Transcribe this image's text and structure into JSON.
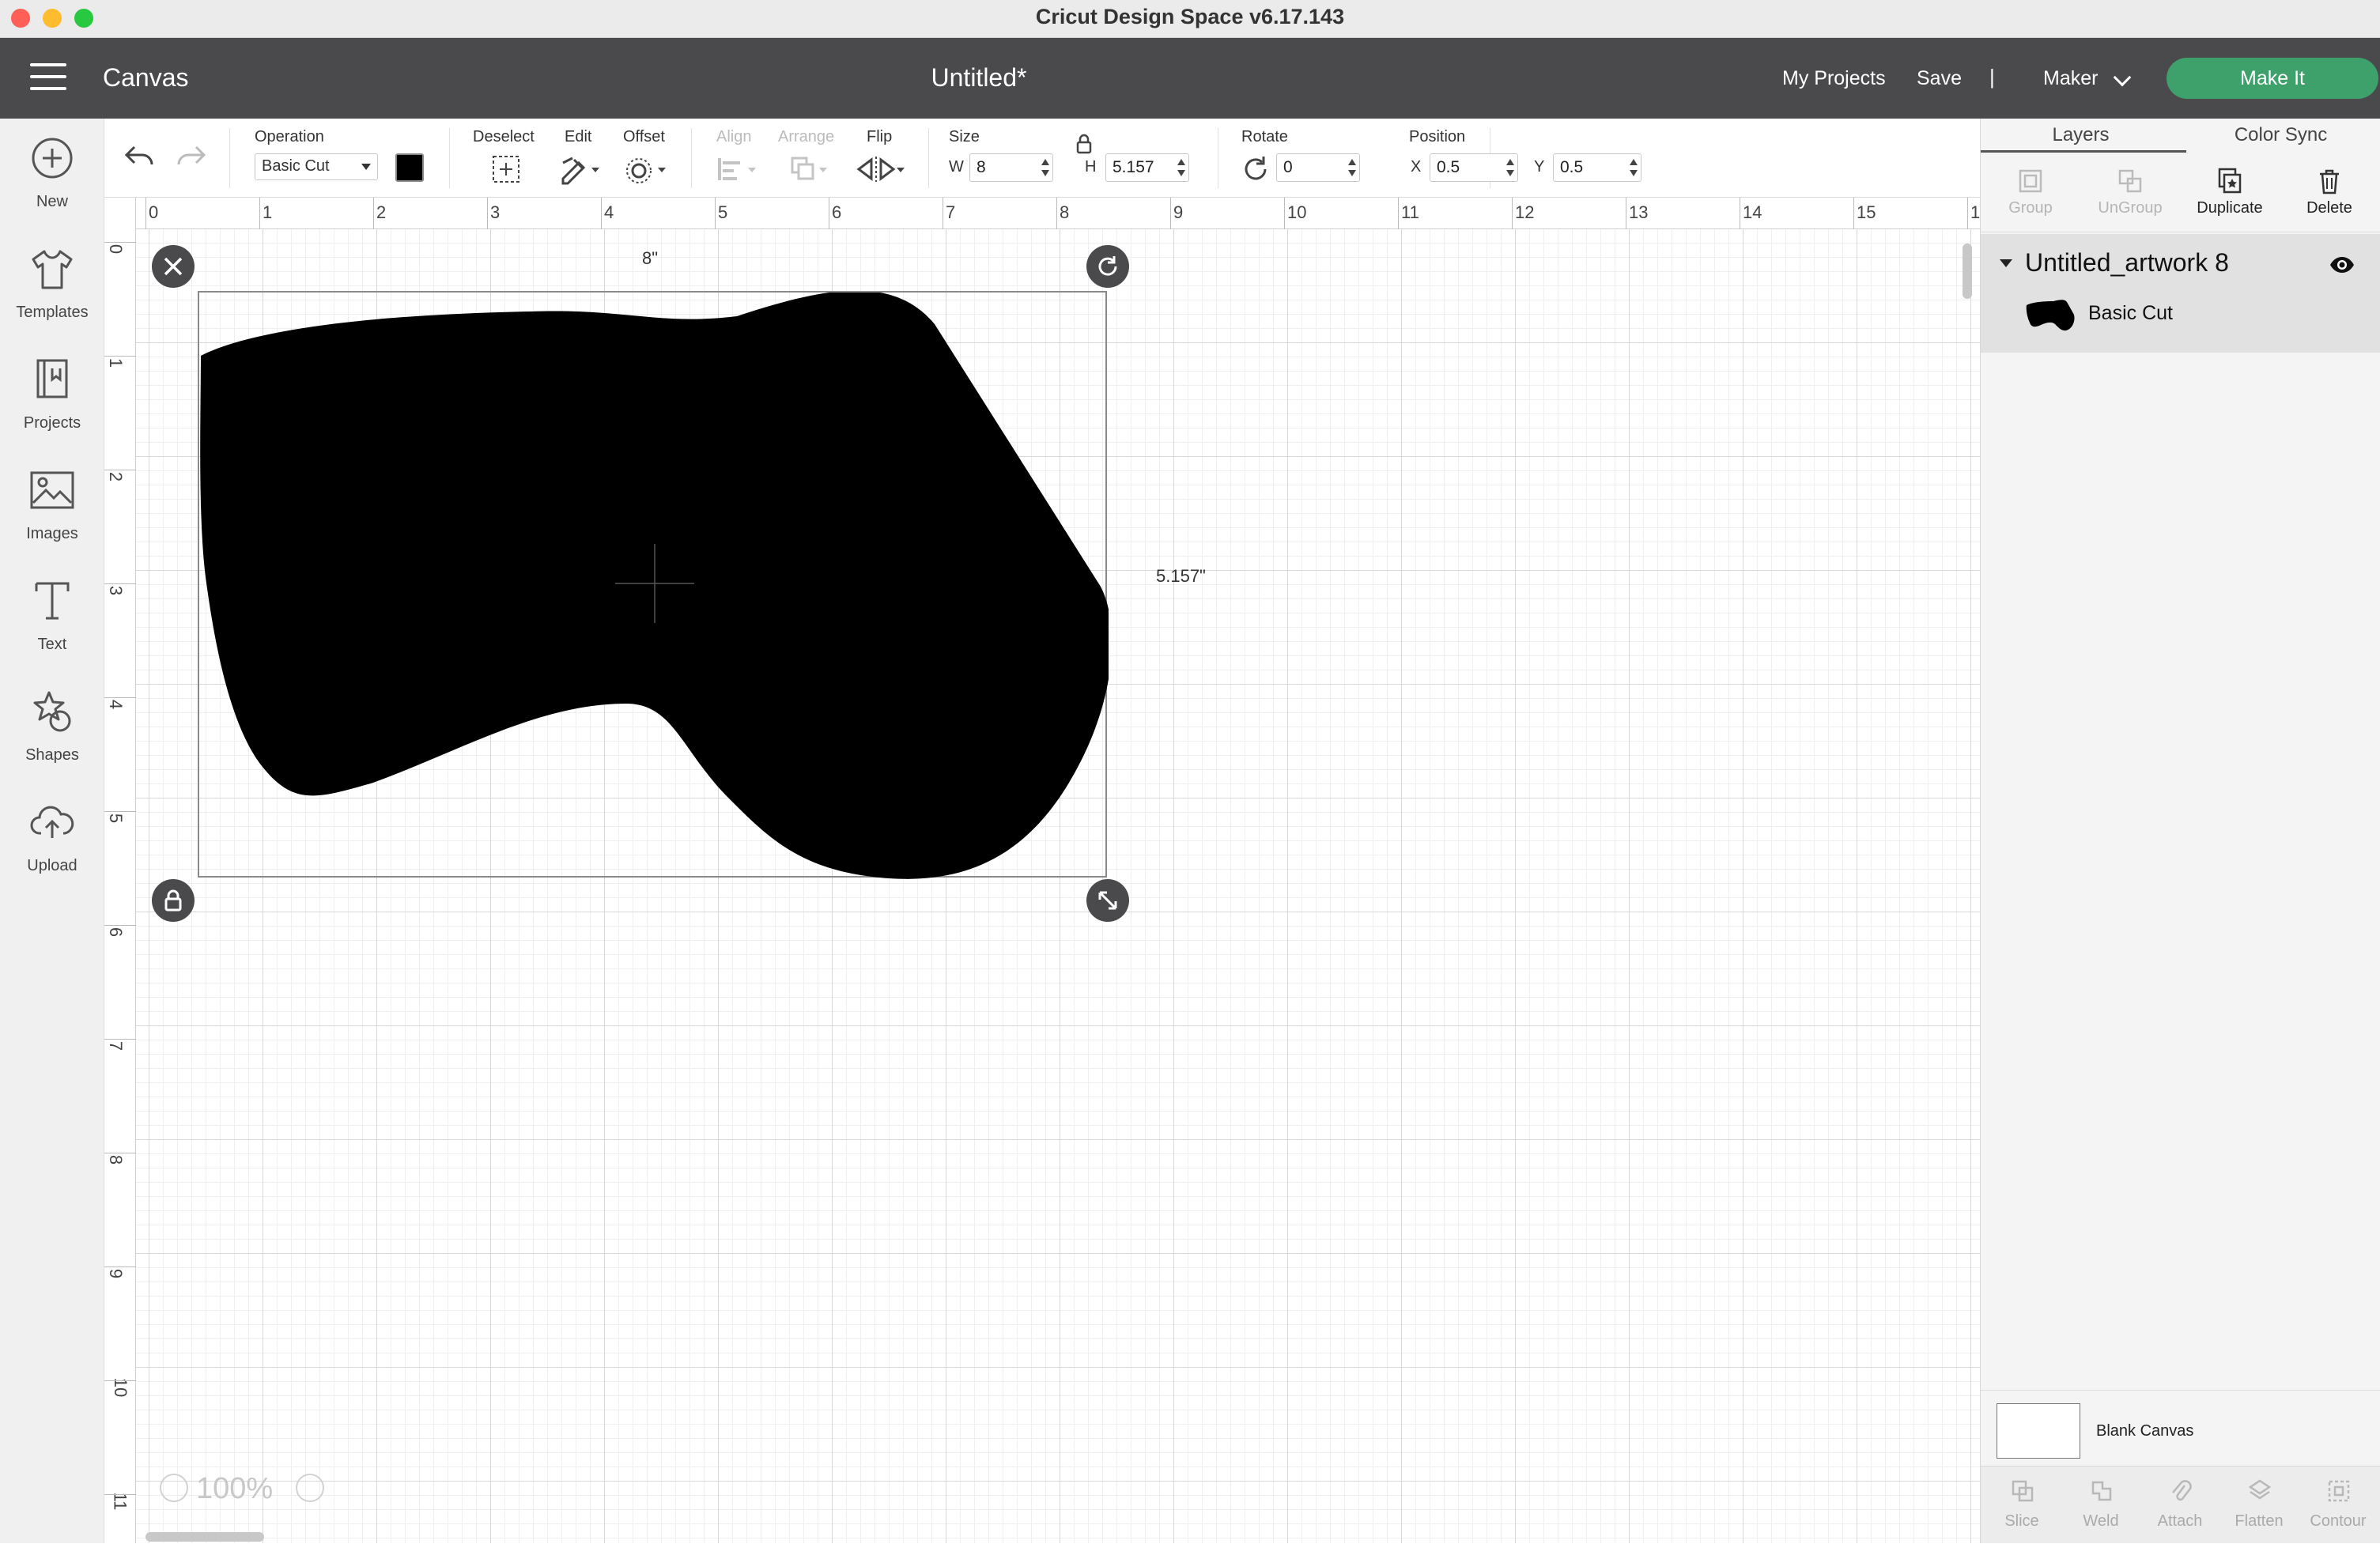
{
  "window": {
    "title": "Cricut Design Space  v6.17.143"
  },
  "header": {
    "section": "Canvas",
    "doc_title": "Untitled*",
    "my_projects": "My Projects",
    "save": "Save",
    "separator": "|",
    "machine": "Maker",
    "make_it": "Make It"
  },
  "sidebar": {
    "items": [
      {
        "label": "New",
        "icon": "plus-circle-icon"
      },
      {
        "label": "Templates",
        "icon": "tshirt-icon"
      },
      {
        "label": "Projects",
        "icon": "projects-icon"
      },
      {
        "label": "Images",
        "icon": "image-icon"
      },
      {
        "label": "Text",
        "icon": "text-icon"
      },
      {
        "label": "Shapes",
        "icon": "shapes-icon"
      },
      {
        "label": "Upload",
        "icon": "cloud-upload-icon"
      }
    ]
  },
  "toolbar": {
    "operation_label": "Operation",
    "operation_value": "Basic Cut",
    "operation_color": "#000000",
    "deselect": "Deselect",
    "edit": "Edit",
    "offset": "Offset",
    "align": "Align",
    "arrange": "Arrange",
    "flip": "Flip",
    "size_label": "Size",
    "w_label": "W",
    "w_value": "8",
    "h_label": "H",
    "h_value": "5.157",
    "rotate_label": "Rotate",
    "rotate_value": "0",
    "position_label": "Position",
    "x_label": "X",
    "x_value": "0.5",
    "y_label": "Y",
    "y_value": "0.5"
  },
  "canvas": {
    "ruler_top": [
      "0",
      "1",
      "2",
      "3",
      "4",
      "5",
      "6",
      "7",
      "8",
      "9",
      "10",
      "11",
      "12",
      "13",
      "14",
      "15",
      "1"
    ],
    "ruler_left": [
      "0",
      "1",
      "2",
      "3",
      "4",
      "5",
      "6",
      "7",
      "8",
      "9",
      "10",
      "11"
    ],
    "width_dim": "8\"",
    "height_dim": "5.157\"",
    "zoom": "100%"
  },
  "right_panel": {
    "tabs": [
      "Layers",
      "Color Sync"
    ],
    "actions": [
      {
        "label": "Group",
        "enabled": false
      },
      {
        "label": "UnGroup",
        "enabled": false
      },
      {
        "label": "Duplicate",
        "enabled": true
      },
      {
        "label": "Delete",
        "enabled": true
      }
    ],
    "layer_group": "Untitled_artwork 8",
    "layer_child": "Basic Cut",
    "blank_canvas": "Blank Canvas",
    "bottom_actions": [
      "Slice",
      "Weld",
      "Attach",
      "Flatten",
      "Contour"
    ]
  }
}
